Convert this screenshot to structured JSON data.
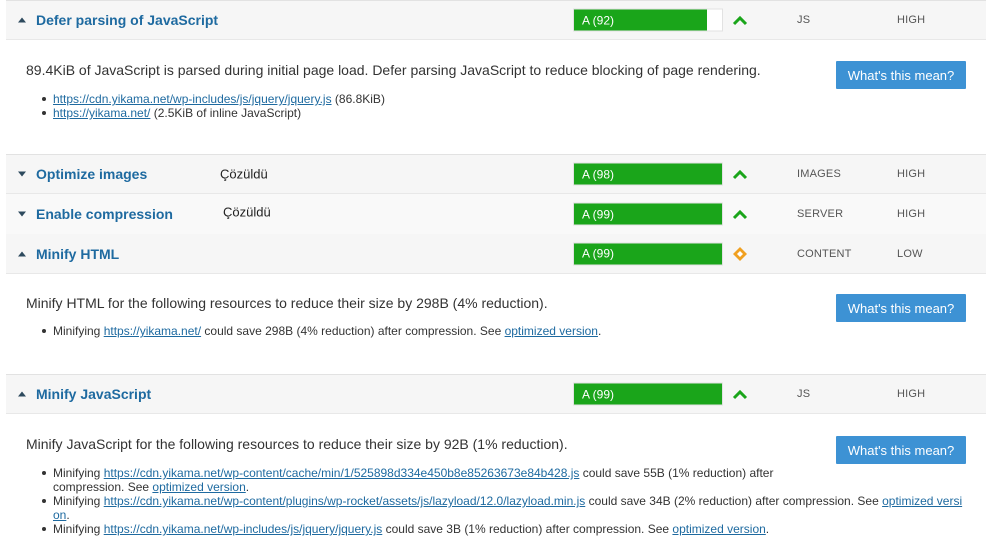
{
  "rows": [
    {
      "title": "Defer parsing of JavaScript",
      "note": "",
      "grade": "A (92)",
      "score": 92,
      "trend": "up",
      "category": "JS",
      "priority": "HIGH",
      "expanded": true
    },
    {
      "title": "Optimize images",
      "note": "Çözüldü",
      "grade": "A (98)",
      "score": 98,
      "trend": "up",
      "category": "IMAGES",
      "priority": "HIGH",
      "expanded": false
    },
    {
      "title": "Enable compression",
      "note": "Çözüldü",
      "grade": "A (99)",
      "score": 99,
      "trend": "up",
      "category": "SERVER",
      "priority": "HIGH",
      "expanded": false
    },
    {
      "title": "Minify HTML",
      "note": "",
      "grade": "A (99)",
      "score": 99,
      "trend": "neutral",
      "category": "CONTENT",
      "priority": "LOW",
      "expanded": true
    },
    {
      "title": "Minify JavaScript",
      "note": "",
      "grade": "A (99)",
      "score": 99,
      "trend": "up",
      "category": "JS",
      "priority": "HIGH",
      "expanded": true
    }
  ],
  "button_label": "What's this mean?",
  "defer": {
    "description": "89.4KiB of JavaScript is parsed during initial page load. Defer parsing JavaScript to reduce blocking of page rendering.",
    "items": [
      {
        "link": "https://cdn.yikama.net/wp-includes/js/jquery/jquery.js",
        "suffix": " (86.8KiB)"
      },
      {
        "link": "https://yikama.net/",
        "suffix": " (2.5KiB of inline JavaScript)"
      }
    ]
  },
  "minify_html": {
    "description": "Minify HTML for the following resources to reduce their size by 298B (4% reduction).",
    "items": [
      {
        "prefix": "Minifying ",
        "link": "https://yikama.net/",
        "middle": " could save 298B (4% reduction) after compression. See ",
        "optimized": "optimized version",
        "end": "."
      }
    ]
  },
  "minify_js": {
    "description": "Minify JavaScript for the following resources to reduce their size by 92B (1% reduction).",
    "items": [
      {
        "prefix": "Minifying ",
        "link": "https://cdn.yikama.net/wp-content/cache/min/1/525898d334e450b8e85263673e84b428.js",
        "middle": " could save 55B (1% reduction) after compression. See ",
        "optimized": "optimized version",
        "end": "."
      },
      {
        "prefix": "Minifying ",
        "link": "https://cdn.yikama.net/wp-content/plugins/wp-rocket/assets/js/lazyload/12.0/lazyload.min.js",
        "middle": " could save 34B (2% reduction) after compression. See ",
        "optimized": "optimized version",
        "end": "."
      },
      {
        "prefix": "Minifying ",
        "link": "https://cdn.yikama.net/wp-includes/js/jquery/jquery.js",
        "middle": " could save 3B (1% reduction) after compression. See ",
        "optimized": "optimized version",
        "end": "."
      }
    ]
  },
  "colors": {
    "grade_bar": "#1aa51a",
    "trend_up": "#1aa51a",
    "trend_neutral": "#f0a020",
    "button": "#3d92d4",
    "link": "#1e6aa0"
  }
}
